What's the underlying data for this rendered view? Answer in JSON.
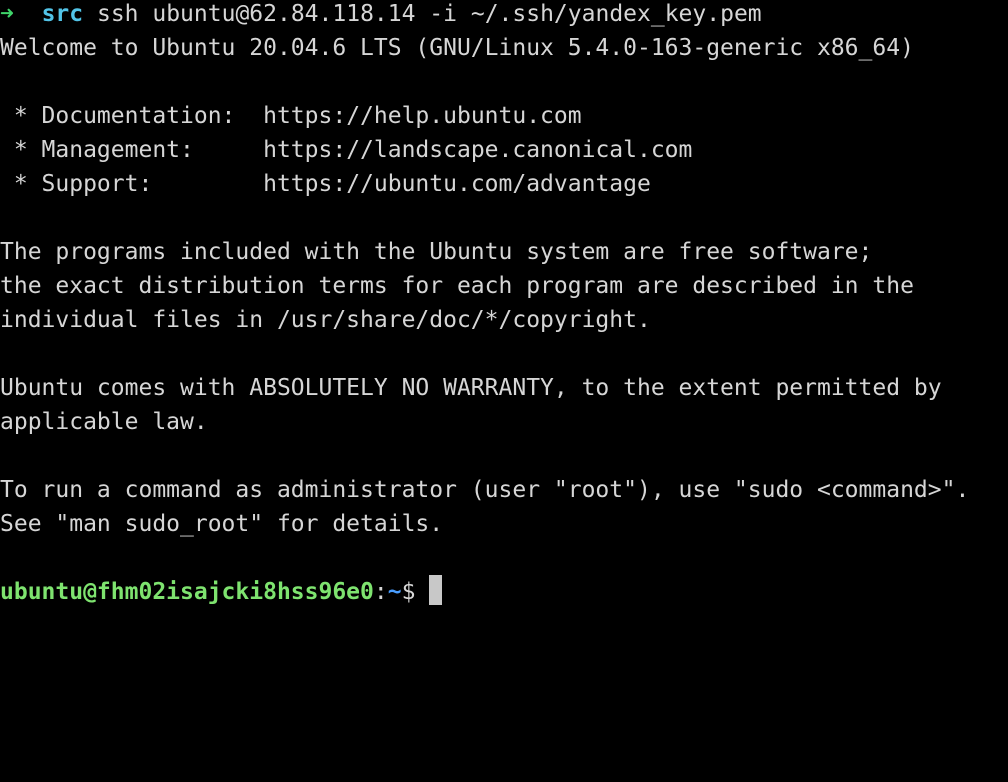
{
  "terminal": {
    "local_prompt": {
      "arrow": "➜",
      "directory": "src",
      "command": "ssh ubuntu@62.84.118.14 -i ~/.ssh/yandex_key.pem"
    },
    "motd": {
      "welcome": "Welcome to Ubuntu 20.04.6 LTS (GNU/Linux 5.4.0-163-generic x86_64)",
      "links": [
        {
          "label": " * Documentation:  ",
          "url": "https://help.ubuntu.com"
        },
        {
          "label": " * Management:     ",
          "url": "https://landscape.canonical.com"
        },
        {
          "label": " * Support:        ",
          "url": "https://ubuntu.com/advantage"
        }
      ],
      "license_lines": [
        "The programs included with the Ubuntu system are free software;",
        "the exact distribution terms for each program are described in the",
        "individual files in /usr/share/doc/*/copyright."
      ],
      "warranty_lines": [
        "Ubuntu comes with ABSOLUTELY NO WARRANTY, to the extent permitted by",
        "applicable law."
      ],
      "sudo_lines": [
        "To run a command as administrator (user \"root\"), use \"sudo <command>\".",
        "See \"man sudo_root\" for details."
      ]
    },
    "remote_prompt": {
      "user_host": "ubuntu@fhm02isajcki8hss96e0",
      "separator": ":",
      "path": "~",
      "symbol": "$ "
    },
    "colors": {
      "background": "#000000",
      "text": "#d6d6d6",
      "arrow": "#3fd46a",
      "directory": "#52c4e8",
      "user_host": "#7ee36f",
      "path": "#4a9eff"
    }
  }
}
